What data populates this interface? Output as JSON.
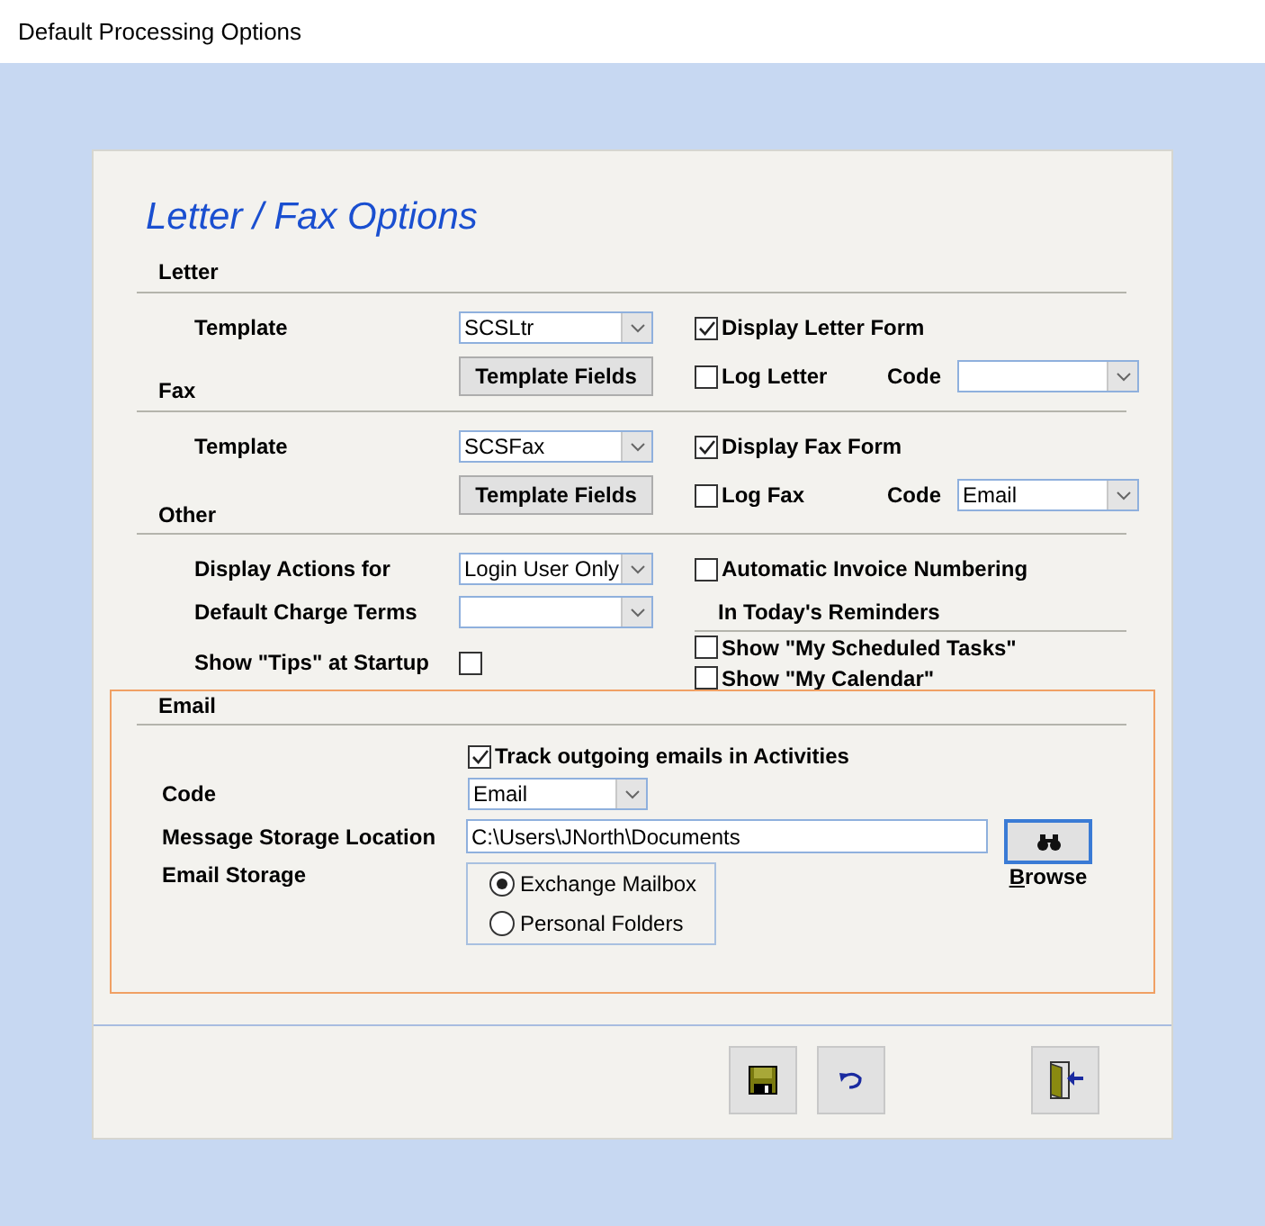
{
  "window": {
    "title": "Default Processing Options"
  },
  "panel_title": "Letter / Fax Options",
  "letter": {
    "heading": "Letter",
    "template_label": "Template",
    "template": "SCSLtr",
    "template_fields_button": "Template Fields",
    "display_form": {
      "label": "Display Letter Form",
      "checked": true
    },
    "log": {
      "label": "Log Letter",
      "checked": false
    },
    "code_label": "Code"
  },
  "fax": {
    "heading": "Fax",
    "template_label": "Template",
    "template": "SCSFax",
    "template_fields_button": "Template Fields",
    "display_form": {
      "label": "Display Fax Form",
      "checked": true
    },
    "log": {
      "label": "Log Fax",
      "checked": false
    },
    "code_label": "Code",
    "code": "Email"
  },
  "other": {
    "heading": "Other",
    "display_actions": {
      "label": "Display Actions for",
      "value": "Login User Only"
    },
    "default_charge_terms": {
      "label": "Default Charge Terms"
    },
    "show_tips": {
      "label": "Show \"Tips\" at Startup",
      "checked": false
    },
    "auto_invoice": {
      "label": "Automatic Invoice Numbering",
      "checked": false
    },
    "reminders": {
      "heading": "In Today's Reminders",
      "items": [
        {
          "label": "Show \"My Scheduled Tasks\"",
          "checked": false
        },
        {
          "label": "Show \"My Calendar\"",
          "checked": false
        }
      ]
    }
  },
  "email": {
    "heading": "Email",
    "highlighted": true,
    "track": {
      "label": "Track outgoing emails in Activities",
      "checked": true
    },
    "code_label": "Code",
    "code": "Email",
    "storage_location_label": "Message Storage Location",
    "storage_location": "C:\\Users\\JNorth\\Documents",
    "browse_label": "Browse",
    "storage_label": "Email Storage",
    "storage_options": [
      {
        "label": "Exchange Mailbox",
        "selected": true
      },
      {
        "label": "Personal Folders",
        "selected": false
      }
    ]
  },
  "toolbar": [
    {
      "kind": "save"
    },
    {
      "kind": "undo"
    },
    {
      "kind": "exit"
    }
  ]
}
